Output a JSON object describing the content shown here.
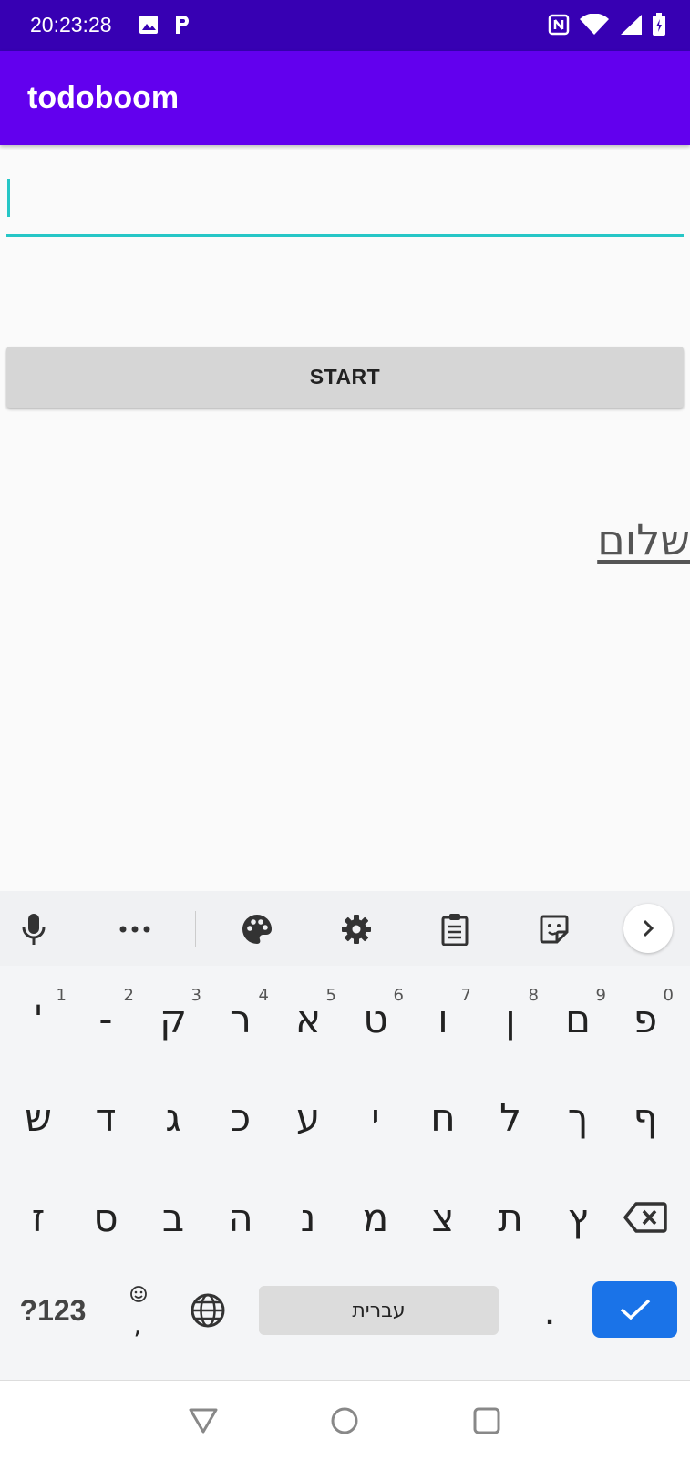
{
  "status_bar": {
    "time": "20:23:28",
    "icons": [
      "image-icon",
      "parking-icon",
      "nfc-icon",
      "wifi-icon",
      "signal-icon",
      "battery-charging-icon"
    ]
  },
  "app_bar": {
    "title": "todoboom"
  },
  "main": {
    "input": {
      "value": "",
      "placeholder": ""
    },
    "start_button": "START",
    "hebrew_link": "שלום"
  },
  "keyboard": {
    "toolbar_icons": [
      "mic-icon",
      "more-icon",
      "palette-icon",
      "settings-icon",
      "clipboard-icon",
      "sticker-icon",
      "chevron-right-icon"
    ],
    "row1": [
      {
        "label": "'",
        "hint": "1"
      },
      {
        "label": "-",
        "hint": "2"
      },
      {
        "label": "ק",
        "hint": "3"
      },
      {
        "label": "ר",
        "hint": "4"
      },
      {
        "label": "א",
        "hint": "5"
      },
      {
        "label": "ט",
        "hint": "6"
      },
      {
        "label": "ו",
        "hint": "7"
      },
      {
        "label": "ן",
        "hint": "8"
      },
      {
        "label": "ם",
        "hint": "9"
      },
      {
        "label": "פ",
        "hint": "0"
      }
    ],
    "row2": [
      "ש",
      "ד",
      "ג",
      "כ",
      "ע",
      "י",
      "ח",
      "ל",
      "ך",
      "ף"
    ],
    "row3": [
      "ז",
      "ס",
      "ב",
      "ה",
      "נ",
      "מ",
      "צ",
      "ת",
      "ץ"
    ],
    "row4": {
      "symbols": "?123",
      "comma": ",",
      "space": "עברית",
      "period": "."
    }
  }
}
